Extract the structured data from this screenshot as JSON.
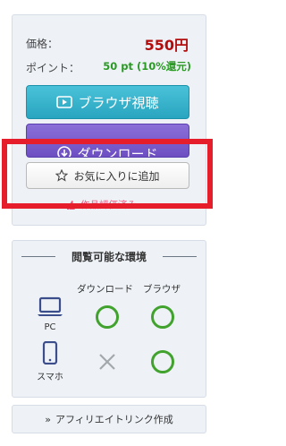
{
  "price": {
    "label": "価格：",
    "value": "550円"
  },
  "points": {
    "label": "ポイント：",
    "value": "50 pt (10%還元)"
  },
  "buttons": {
    "browser": "ブラウザ視聴",
    "download": "ダウンロード",
    "favorite": "お気に入りに追加"
  },
  "review": {
    "text": "作品評価済み"
  },
  "environment": {
    "title": "閲覧可能な環境",
    "columns": [
      "ダウンロード",
      "ブラウザ"
    ],
    "devices": [
      {
        "name": "PC",
        "download": "available",
        "browser": "available"
      },
      {
        "name": "スマホ",
        "download": "unavailable",
        "browser": "available"
      }
    ]
  },
  "affiliate": {
    "label": "アフィリエイトリンク作成",
    "chevron": "»"
  },
  "colors": {
    "price": "#b40d0d",
    "points": "#2b9a25",
    "browser_button": "#2aa5c0",
    "download_button": "#6d4fc2",
    "highlight": "#e61e2b",
    "available_mark": "#41a32d"
  },
  "icons": [
    "play-icon",
    "download-icon",
    "star-icon",
    "thumbs-up-icon",
    "laptop-icon",
    "smartphone-icon",
    "circle-icon",
    "cross-icon",
    "chevron-double-right-icon"
  ]
}
